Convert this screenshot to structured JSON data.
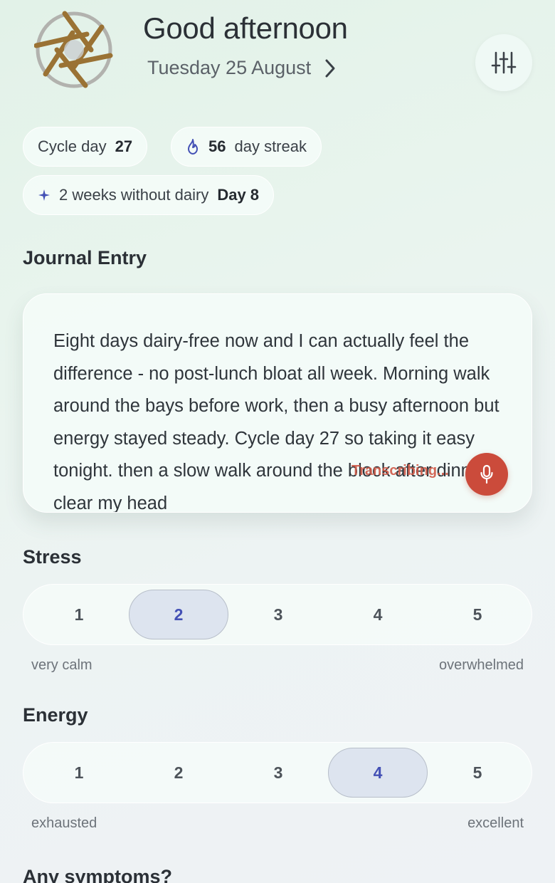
{
  "header": {
    "greeting": "Good afternoon",
    "date": "Tuesday 25 August"
  },
  "chips": {
    "cycle": {
      "label": "Cycle day",
      "value": "27"
    },
    "streak": {
      "value": "56",
      "label": "day streak"
    },
    "challenge": {
      "label": "2 weeks without dairy",
      "value": "Day 8"
    }
  },
  "journal": {
    "title": "Journal Entry",
    "text": "Eight days dairy-free now and I can actually feel the difference - no post-lunch bloat all week. Morning walk around the bays before work, then a busy afternoon but energy stayed steady. Cycle day 27 so taking it easy tonight. then a slow walk around the block after dinner to clear my head",
    "status": "Transcribing..."
  },
  "stress": {
    "title": "Stress",
    "options": [
      "1",
      "2",
      "3",
      "4",
      "5"
    ],
    "selected": 2,
    "min_label": "very calm",
    "max_label": "overwhelmed"
  },
  "energy": {
    "title": "Energy",
    "options": [
      "1",
      "2",
      "3",
      "4",
      "5"
    ],
    "selected": 4,
    "min_label": "exhausted",
    "max_label": "excellent"
  },
  "symptoms": {
    "title": "Any symptoms?"
  },
  "colors": {
    "accent": "#4350b5",
    "record": "#cb4b3b",
    "logo": "#9a7234"
  },
  "icons": {
    "logo": "pinwheel-logo",
    "settings": "sliders-icon",
    "date_next": "chevron-right-icon",
    "streak": "flame-icon",
    "challenge": "sparkle-icon",
    "record": "microphone-icon"
  }
}
